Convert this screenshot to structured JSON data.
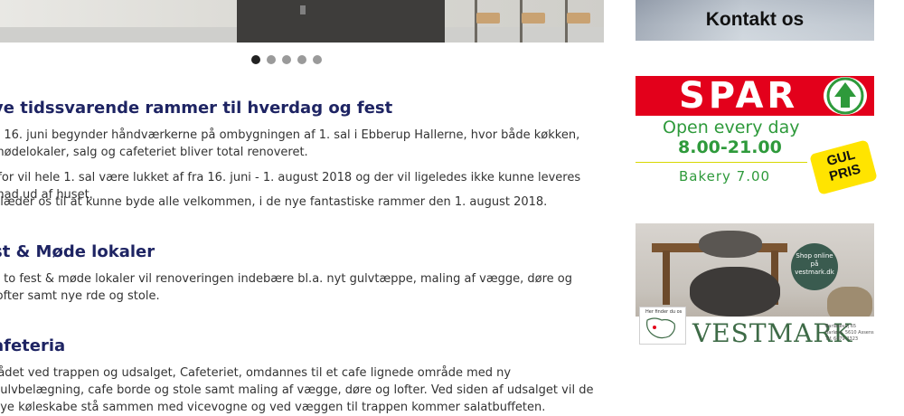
{
  "carousel": {
    "dot_count": 5,
    "active_index": 0
  },
  "article": {
    "heading_1": "ye tidssvarende rammer til hverdag og fest",
    "para_1": "n 16. juni begynder håndværkerne på ombygningen af 1. sal i Ebberup Hallerne, hvor både køkken, mødelokaler, salg og cafeteriet bliver total renoveret.",
    "para_2": "rfor vil hele 1. sal være lukket af fra 16. juni - 1. august 2018 og der vil ligeledes ikke kunne leveres mad ud af huset.",
    "para_3": "glæder os til at kunne byde alle velkommen, i de nye fantastiske rammer den 1. august 2018.",
    "heading_2": "st & Møde lokaler",
    "para_4": "e to fest & møde lokaler vil renoveringen indebære bl.a. nyt gulvtæppe, maling af vægge, døre og lofter samt nye rde og stole.",
    "heading_3": "afeteria",
    "para_5": "rådet ved trappen og udsalget, Cafeteriet, omdannes til et cafe lignede område med ny gulvbelægning, cafe borde og stole samt maling af vægge, døre og lofter. Ved siden af udsalget vil de nye køleskabe stå sammen med vicevogne og ved væggen til trappen kommer salatbuffeten."
  },
  "sidebar": {
    "kontakt_label": "Kontakt os",
    "spar": {
      "logo": "SPAR",
      "open_text": "Open every day",
      "hours": "8.00-21.00",
      "bakery": "Bakery 7.00",
      "badge": "GUL PRIS",
      "brand_red": "#e3001b",
      "brand_green": "#2e9a3b"
    },
    "vestmark": {
      "brand": "VESTMARK",
      "badge_text": "Shop online på vestmark.dk",
      "map_text": "Her finder du os",
      "address_1": "Barløsevej 65",
      "address_2": "Barløse, 5610 Assens",
      "phone": "Tlf. 6479 2323",
      "brand_green": "#3e6b47"
    }
  }
}
